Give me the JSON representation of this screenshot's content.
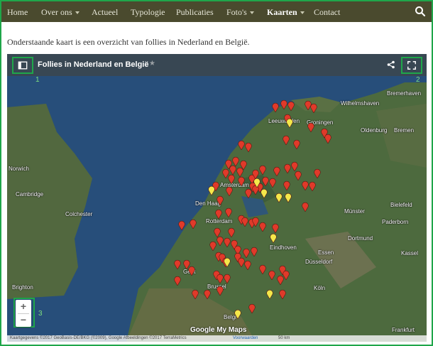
{
  "nav": {
    "items": [
      {
        "label": "Home",
        "has_menu": false
      },
      {
        "label": "Over ons",
        "has_menu": true
      },
      {
        "label": "Actueel",
        "has_menu": false
      },
      {
        "label": "Typologie",
        "has_menu": false
      },
      {
        "label": "Publicaties",
        "has_menu": false
      },
      {
        "label": "Foto's",
        "has_menu": true
      },
      {
        "label": "Kaarten",
        "has_menu": true,
        "active": true
      },
      {
        "label": "Contact",
        "has_menu": false
      }
    ],
    "search_icon": "search-icon"
  },
  "intro": "Onderstaande kaart is een overzicht van follies in Nederland en België.",
  "map": {
    "title": "Follies in Nederland en België",
    "annotations": [
      "1",
      "2",
      "3"
    ],
    "zoom_in": "+",
    "zoom_out": "−",
    "places": [
      {
        "name": "Leeuwarden"
      },
      {
        "name": "Groningen"
      },
      {
        "name": "Wilhelmshaven"
      },
      {
        "name": "Oldenburg"
      },
      {
        "name": "Bremen"
      },
      {
        "name": "Bremerhaven"
      },
      {
        "name": "Norwich"
      },
      {
        "name": "Cambridge"
      },
      {
        "name": "Colchester"
      },
      {
        "name": "Amsterdam"
      },
      {
        "name": "Den Haag"
      },
      {
        "name": "Rotterdam"
      },
      {
        "name": "Eindhoven"
      },
      {
        "name": "Bielefeld"
      },
      {
        "name": "Münster"
      },
      {
        "name": "Dortmund"
      },
      {
        "name": "Essen"
      },
      {
        "name": "Düsseldorf"
      },
      {
        "name": "Köln"
      },
      {
        "name": "Kassel"
      },
      {
        "name": "Gent"
      },
      {
        "name": "Brussel"
      },
      {
        "name": "Belgi"
      },
      {
        "name": "Frankfurt"
      },
      {
        "name": "Brighton"
      },
      {
        "name": "Paderborn"
      }
    ],
    "footer": {
      "attribution": "Kaartgegevens ©2017 GeoBasis-DE/BKG (©2009), Google Afbeeldingen ©2017 TerraMetrics",
      "terms": "Voorwaarden",
      "scale": "50 km"
    },
    "google_logo": "Google My Maps"
  }
}
